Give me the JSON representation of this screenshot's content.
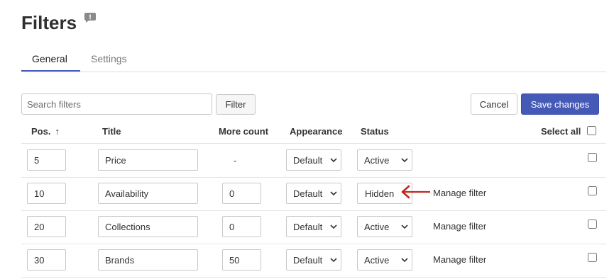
{
  "page": {
    "title": "Filters"
  },
  "tabs": [
    {
      "label": "General",
      "active": true
    },
    {
      "label": "Settings",
      "active": false
    }
  ],
  "toolbar": {
    "search_placeholder": "Search filters",
    "filter_label": "Filter",
    "cancel_label": "Cancel",
    "save_label": "Save changes"
  },
  "table": {
    "headers": {
      "pos": "Pos.",
      "sort_arrow": "↑",
      "title": "Title",
      "more_count": "More count",
      "appearance": "Appearance",
      "status": "Status",
      "select_all": "Select all"
    },
    "rows": [
      {
        "pos": "5",
        "title": "Price",
        "more_count": "-",
        "appearance": "Default",
        "status": "Active",
        "manage": ""
      },
      {
        "pos": "10",
        "title": "Availability",
        "more_count": "0",
        "appearance": "Default",
        "status": "Hidden",
        "manage": "Manage filter"
      },
      {
        "pos": "20",
        "title": "Collections",
        "more_count": "0",
        "appearance": "Default",
        "status": "Active",
        "manage": "Manage filter"
      },
      {
        "pos": "30",
        "title": "Brands",
        "more_count": "50",
        "appearance": "Default",
        "status": "Active",
        "manage": "Manage filter"
      }
    ]
  },
  "colors": {
    "accent": "#4559b6",
    "annotation_arrow": "#c0291e"
  }
}
